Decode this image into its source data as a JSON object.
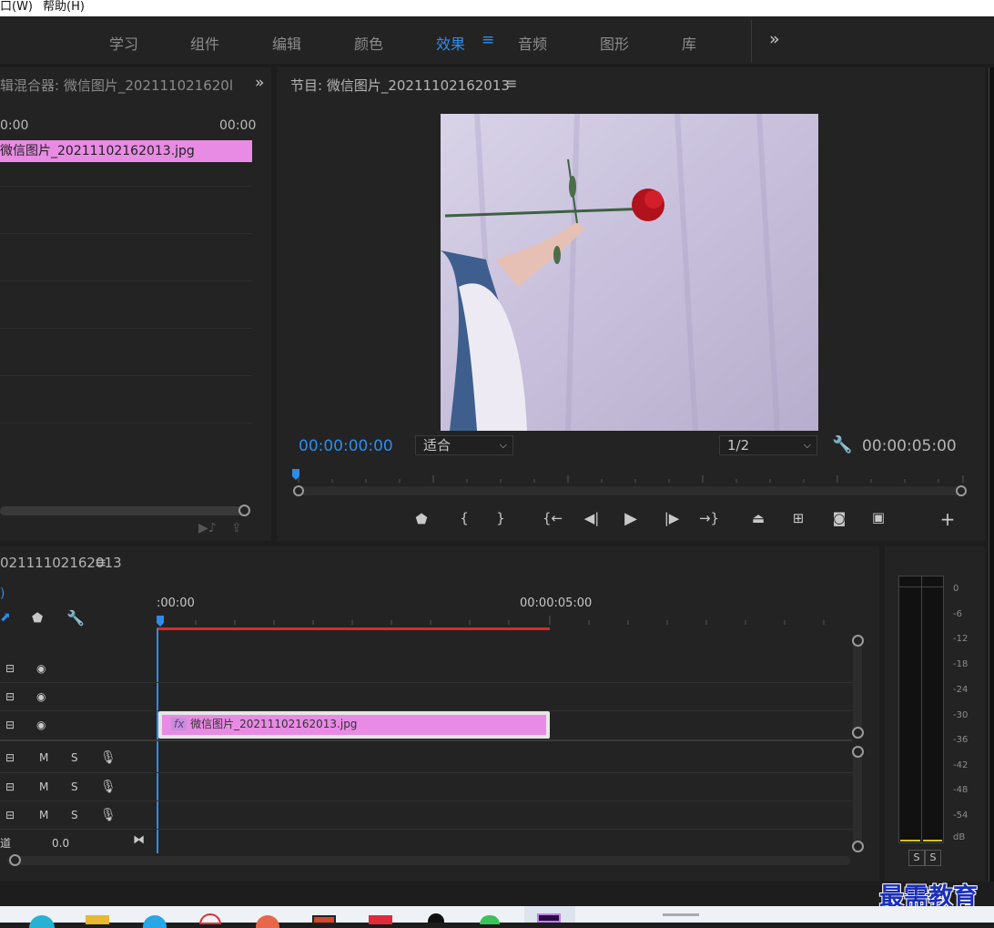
{
  "menu": {
    "window": "口(W)",
    "help": "帮助(H)"
  },
  "workspaces": [
    "学习",
    "组件",
    "编辑",
    "颜色",
    "效果",
    "音频",
    "图形",
    "库"
  ],
  "workspace_active_index": 4,
  "workspace_more": "»",
  "source_panel": {
    "title": "辑混合器: 微信图片_202111021620l",
    "time_left": "0:00",
    "time_right": "00:00",
    "clip_name": "微信图片_20211102162013.jpg",
    "expand": "»"
  },
  "program_panel": {
    "title": "节目: 微信图片_20211102162013",
    "menu_icon": "≡",
    "current_time": "00:00:00:00",
    "zoom": "适合",
    "resolution": "1/2",
    "duration": "00:00:05:00"
  },
  "timeline": {
    "title": "02111102162013",
    "menu_icon": "≡",
    "ruler_start": ":00:00",
    "ruler_mid": "00:00:05:00",
    "clip_name": "微信图片_20211102162013.jpg",
    "fx": "fx",
    "master_label": "道",
    "master_value": "0.0",
    "audio_m": "M",
    "audio_s": "S"
  },
  "meter": {
    "labels": [
      "0",
      "-6",
      "-12",
      "-18",
      "-24",
      "-30",
      "-36",
      "-42",
      "-48",
      "-54",
      "dB"
    ],
    "solo_left": "S",
    "solo_right": "S"
  },
  "watermark": "最需教育",
  "colors": {
    "accent": "#2d8ceb",
    "clip": "#e88be4",
    "playhead_range": "#e0262a"
  }
}
